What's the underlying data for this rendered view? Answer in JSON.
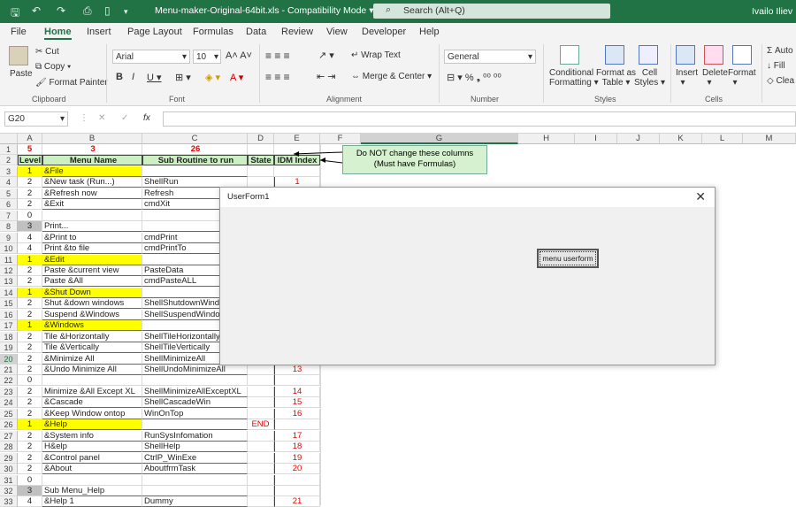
{
  "titlebar": {
    "filename": "Menu-maker-Original-64bit.xls",
    "mode": "Compatibility Mode",
    "search_placeholder": "Search (Alt+Q)",
    "user": "Ivailo Iliev"
  },
  "menu": [
    "File",
    "Home",
    "Insert",
    "Page Layout",
    "Formulas",
    "Data",
    "Review",
    "View",
    "Developer",
    "Help"
  ],
  "ribbon": {
    "paste": "Paste",
    "cut": "Cut",
    "copy": "Copy",
    "format_painter": "Format Painter",
    "clipboard": "Clipboard",
    "font_name": "Arial",
    "font_size": "10",
    "font": "Font",
    "wrap_text": "Wrap Text",
    "merge_center": "Merge & Center",
    "alignment": "Alignment",
    "number_format": "General",
    "number": "Number",
    "cond_format": "Conditional",
    "cond_format2": "Formatting",
    "format_table": "Format as",
    "format_table2": "Table",
    "cell_styles": "Cell",
    "cell_styles2": "Styles",
    "styles": "Styles",
    "insert": "Insert",
    "delete": "Delete",
    "format": "Format",
    "cells": "Cells",
    "autosum": "Auto",
    "fill": "Fill",
    "clear": "Clea"
  },
  "name_box": "G20",
  "fx": "fx",
  "col_headers": [
    "A",
    "B",
    "C",
    "D",
    "E",
    "F",
    "G",
    "H",
    "I",
    "J",
    "K",
    "L",
    "M"
  ],
  "rows": [
    {
      "n": "1",
      "a": "5",
      "b": "3",
      "c": "26",
      "d": "",
      "e": ""
    },
    {
      "n": "2",
      "a": "Level",
      "b": "Menu Name",
      "c": "Sub Routine to run",
      "d": "State",
      "e": "IDM Index"
    },
    {
      "n": "3",
      "a": "1",
      "b": "&File",
      "c": "",
      "d": "",
      "e": ""
    },
    {
      "n": "4",
      "a": "2",
      "b": "&New task (Run...)",
      "c": "ShellRun",
      "d": "",
      "e": "1"
    },
    {
      "n": "5",
      "a": "2",
      "b": "&Refresh now",
      "c": "Refresh",
      "d": "",
      "e": ""
    },
    {
      "n": "6",
      "a": "2",
      "b": "&Exit",
      "c": "cmdXit",
      "d": "",
      "e": ""
    },
    {
      "n": "7",
      "a": "0",
      "b": "",
      "c": "",
      "d": "",
      "e": ""
    },
    {
      "n": "8",
      "a": "3",
      "b": "Print...",
      "c": "",
      "d": "",
      "e": ""
    },
    {
      "n": "9",
      "a": "4",
      "b": "&Print to",
      "c": "cmdPrint",
      "d": "",
      "e": ""
    },
    {
      "n": "10",
      "a": "4",
      "b": "Print &to file",
      "c": "cmdPrintTo",
      "d": "",
      "e": ""
    },
    {
      "n": "11",
      "a": "1",
      "b": "&Edit",
      "c": "",
      "d": "",
      "e": ""
    },
    {
      "n": "12",
      "a": "2",
      "b": "Paste &current view",
      "c": "PasteData",
      "d": "",
      "e": ""
    },
    {
      "n": "13",
      "a": "2",
      "b": "Paste &All",
      "c": "cmdPasteALL",
      "d": "",
      "e": ""
    },
    {
      "n": "14",
      "a": "1",
      "b": "&Shut Down",
      "c": "",
      "d": "",
      "e": ""
    },
    {
      "n": "15",
      "a": "2",
      "b": "Shut &down windows",
      "c": "ShellShutdownWind",
      "d": "",
      "e": ""
    },
    {
      "n": "16",
      "a": "2",
      "b": "Suspend &Windows",
      "c": "ShellSuspendWindo",
      "d": "",
      "e": ""
    },
    {
      "n": "17",
      "a": "1",
      "b": "&Windows",
      "c": "",
      "d": "",
      "e": ""
    },
    {
      "n": "18",
      "a": "2",
      "b": "Tile &Horizontally",
      "c": "ShellTileHorizontally",
      "d": "",
      "e": ""
    },
    {
      "n": "19",
      "a": "2",
      "b": "Tile &Vertically",
      "c": "ShellTileVertically",
      "d": "",
      "e": ""
    },
    {
      "n": "20",
      "a": "2",
      "b": "&Minimize All",
      "c": "ShellMinimizeAll",
      "d": "",
      "e": ""
    },
    {
      "n": "21",
      "a": "2",
      "b": "&Undo Minimize All",
      "c": "ShellUndoMinimizeAll",
      "d": "",
      "e": "13"
    },
    {
      "n": "22",
      "a": "0",
      "b": "",
      "c": "",
      "d": "",
      "e": ""
    },
    {
      "n": "23",
      "a": "2",
      "b": "Minimize &All Except XL",
      "c": "ShellMinimizeAllExceptXL",
      "d": "",
      "e": "14"
    },
    {
      "n": "24",
      "a": "2",
      "b": "&Cascade",
      "c": "ShellCascadeWin",
      "d": "",
      "e": "15"
    },
    {
      "n": "25",
      "a": "2",
      "b": "&Keep Window ontop",
      "c": "WinOnTop",
      "d": "",
      "e": "16"
    },
    {
      "n": "26",
      "a": "1",
      "b": "&Help",
      "c": "",
      "d": "END",
      "e": ""
    },
    {
      "n": "27",
      "a": "2",
      "b": "&System info",
      "c": "RunSysInfomation",
      "d": "",
      "e": "17"
    },
    {
      "n": "28",
      "a": "2",
      "b": "H&elp",
      "c": "ShellHelp",
      "d": "",
      "e": "18"
    },
    {
      "n": "29",
      "a": "2",
      "b": "&Control panel",
      "c": "CtrlP_WinExe",
      "d": "",
      "e": "19"
    },
    {
      "n": "30",
      "a": "2",
      "b": "&About",
      "c": "AboutfrmTask",
      "d": "",
      "e": "20"
    },
    {
      "n": "31",
      "a": "0",
      "b": "",
      "c": "",
      "d": "",
      "e": ""
    },
    {
      "n": "32",
      "a": "3",
      "b": "Sub Menu_Help",
      "c": "",
      "d": "",
      "e": ""
    },
    {
      "n": "33",
      "a": "4",
      "b": "&Help 1",
      "c": "Dummy",
      "d": "",
      "e": "21"
    }
  ],
  "note": {
    "line1": "Do NOT change these columns",
    "line2": "(Must have Formulas)"
  },
  "userform": {
    "title": "UserForm1",
    "button": "menu userform"
  }
}
